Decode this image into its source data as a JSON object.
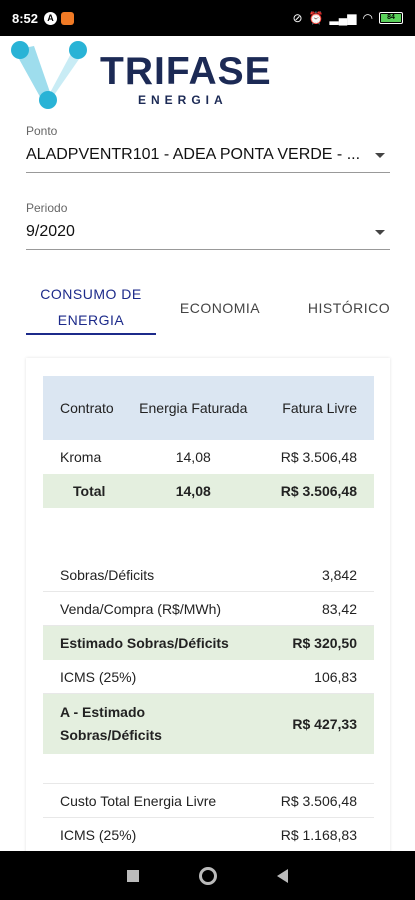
{
  "status": {
    "time": "8:52",
    "left_icons": [
      "a-icon",
      "app-notification-icon"
    ],
    "right_icons": [
      "dnd-icon",
      "alarm-icon",
      "signal-icon",
      "wifi-icon",
      "battery-icon"
    ],
    "battery_level": "84"
  },
  "logo": {
    "brand": "TRIFASE",
    "sub": "ENERGIA",
    "colors": {
      "accent": "#29b3d6",
      "navy": "#1c2a55"
    }
  },
  "ponto": {
    "label": "Ponto",
    "value": "ALADPVENTR101 - ADEA PONTA VERDE - ..."
  },
  "periodo": {
    "label": "Periodo",
    "value": "9/2020"
  },
  "tabs": {
    "t1": "CONSUMO DE ENERGIA",
    "t2": "ECONOMIA",
    "t3": "HISTÓRICO"
  },
  "table": {
    "headers": [
      "Contrato",
      "Energia Faturada",
      "Fatura Livre"
    ],
    "rows": [
      [
        "Kroma",
        "14,08",
        "R$ 3.506,48"
      ]
    ],
    "total": [
      "Total",
      "14,08",
      "R$ 3.506,48"
    ]
  },
  "summary": {
    "sobras_label": "Sobras/Déficits",
    "sobras_value": "3,842",
    "venda_label": "Venda/Compra (R$/MWh)",
    "venda_value": "83,42",
    "estimado_label": "Estimado Sobras/Déficits",
    "estimado_value": "R$ 320,50",
    "icms1_label": "ICMS (25%)",
    "icms1_value": "106,83",
    "a_label": "A - Estimado Sobras/Déficits",
    "a_value": "R$ 427,33",
    "custo_label": "Custo Total Energia Livre",
    "custo_value": "R$ 3.506,48",
    "icms2_label": "ICMS (25%)",
    "icms2_value": "R$ 1.168,83"
  },
  "colors": {
    "header_bg": "#dbe6f2",
    "highlight_bg": "#e4efdf",
    "tab_active": "#1c2a8a"
  }
}
